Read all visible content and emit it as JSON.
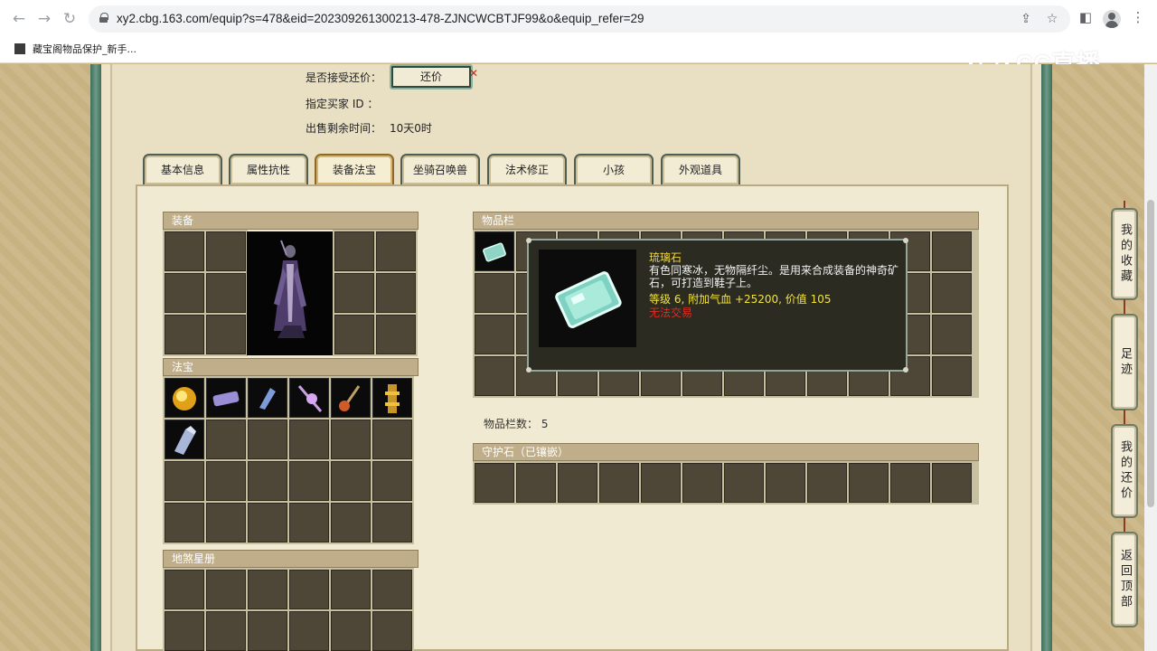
{
  "browser": {
    "url": "xy2.cbg.163.com/equip?s=478&eid=202309261300213-478-ZJNCWCBTJF99&o&equip_refer=29",
    "bookmark_label": "藏宝阁物品保护_新手...",
    "icons": [
      "back-icon",
      "forward-icon",
      "reload-icon",
      "lock-icon",
      "share-icon",
      "star-icon",
      "sidepanel-icon",
      "profile-icon",
      "menu-icon"
    ]
  },
  "watermark": {
    "text": "CC直播"
  },
  "listing": {
    "accept_counter_label": "是否接受还价：",
    "counter_button": "还价",
    "buyer_id_label": "指定买家 ID ：",
    "time_left_label": "出售剩余时间：",
    "time_left_value": "10天0时"
  },
  "tabs": [
    {
      "label": "基本信息",
      "active": false
    },
    {
      "label": "属性抗性",
      "active": false
    },
    {
      "label": "装备法宝",
      "active": true
    },
    {
      "label": "坐骑召唤兽",
      "active": false
    },
    {
      "label": "法术修正",
      "active": false
    },
    {
      "label": "小孩",
      "active": false
    },
    {
      "label": "外观道具",
      "active": false
    }
  ],
  "panels": {
    "equipment": "装备",
    "fabao": "法宝",
    "dishaxingce": "地煞星册",
    "inventory": "物品栏",
    "inventory_count_label": "物品栏数：",
    "inventory_count_value": "5",
    "guardian_stone": "守护石（已镶嵌）"
  },
  "fabao_items": [
    "fabao-gold-orb",
    "fabao-scroll",
    "fabao-claw",
    "fabao-crystal-staff",
    "fabao-fire-gourd",
    "fabao-golden-pagoda",
    "fabao-gauntlet"
  ],
  "tooltip": {
    "name": "琉璃石",
    "description": "有色同寒冰，无物隔纤尘。是用来合成装备的神奇矿石，可打造到鞋子上。",
    "stats": "等级 6, 附加气血 +25200, 价值 105",
    "trade": "无法交易"
  },
  "side_buttons": [
    "我的收藏",
    "足迹",
    "我的还价",
    "返回顶部"
  ],
  "colors": {
    "accent_gold": "#f3d73a",
    "warning_red": "#e42b1d",
    "frame_green": "#3e6d5a"
  }
}
